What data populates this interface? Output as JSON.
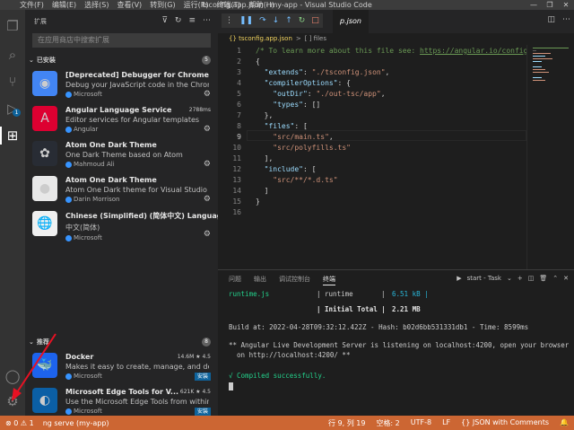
{
  "titlebar": {
    "menu": [
      "文件(F)",
      "编辑(E)",
      "选择(S)",
      "查看(V)",
      "转到(G)",
      "运行(R)",
      "终端(T)",
      "帮助(H)"
    ],
    "title": "tsconfig.app.json - my-app - Visual Studio Code",
    "controls": [
      "—",
      "❐",
      "✕"
    ]
  },
  "activity": {
    "badge": "1"
  },
  "sidebar": {
    "header": "扩展",
    "search_placeholder": "在应用商店中搜索扩展",
    "installed": {
      "label": "已安装",
      "count": "5"
    },
    "recommended": {
      "label": "推荐",
      "count": "8"
    },
    "installed_items": [
      {
        "name": "[Deprecated] Debugger for Chrome",
        "desc": "Debug your JavaScript code in the Chrome ...",
        "pub": "Microsoft",
        "color": "#4285f4",
        "glyph": "◉"
      },
      {
        "name": "Angular Language Service",
        "desc": "Editor services for Angular templates",
        "pub": "Angular",
        "meta": "2788ms",
        "color": "#dd0031",
        "glyph": "A"
      },
      {
        "name": "Atom One Dark Theme",
        "desc": "One Dark Theme based on Atom",
        "pub": "Mahmoud Ali",
        "color": "#282c34",
        "glyph": "✿"
      },
      {
        "name": "Atom One Dark Theme",
        "desc": "Atom One Dark theme for Visual Studio Co...",
        "pub": "Darin Morrison",
        "color": "#e8e8e8",
        "glyph": "●"
      },
      {
        "name": "Chinese (Simplified) (简体中文) Languag...",
        "desc": "中文(简体)",
        "pub": "Microsoft",
        "color": "#f0f0f0",
        "glyph": "🌐"
      }
    ],
    "recommended_items": [
      {
        "name": "Docker",
        "desc": "Makes it easy to create, manage, and debu...",
        "pub": "Microsoft",
        "meta": "14.6M ★ 4.5",
        "install": "安装",
        "color": "#1d63ed",
        "glyph": "🐳"
      },
      {
        "name": "Microsoft Edge Tools for V...",
        "desc": "Use the Microsoft Edge Tools from within V...",
        "pub": "Microsoft",
        "meta": "621K ★ 4.5",
        "install": "安装",
        "color": "#0b5fa5",
        "glyph": "◐"
      }
    ]
  },
  "editor": {
    "tab": "tsconfig.app.json",
    "tab_visible": "p.json",
    "breadcrumb": [
      "{} tsconfig.app.json",
      ">",
      "[ ] files"
    ],
    "lines": [
      "/* To learn more about this file see: https://angular.io/config",
      "{",
      "  \"extends\": \"./tsconfig.json\",",
      "  \"compilerOptions\": {",
      "    \"outDir\": \"./out-tsc/app\",",
      "    \"types\": []",
      "  },",
      "  \"files\": [",
      "    \"src/main.ts\",",
      "    \"src/polyfills.ts\"",
      "  ],",
      "  \"include\": [",
      "    \"src/**/*.d.ts\"",
      "  ]",
      "}",
      ""
    ]
  },
  "panel": {
    "tabs": [
      "问题",
      "输出",
      "调试控制台",
      "终端"
    ],
    "active_tab": "终端",
    "task": "start - Task",
    "terminal": [
      {
        "a": "runtime.js",
        "b": "| runtime",
        "c": "|",
        "d": "6.51 kB |"
      },
      {
        "a": "",
        "b": "| Initial Total |",
        "c": "",
        "d": "2.21 MB"
      },
      {
        "line": "Build at: 2022-04-28T09:32:12.422Z - Hash: b02d6bb531331db1 - Time: 8599ms"
      },
      {
        "line": "** Angular Live Development Server is listening on localhost:4200, open your browser"
      },
      {
        "line": "  on http://localhost:4200/ **"
      },
      {
        "line": "√ Compiled successfully."
      }
    ]
  },
  "status": {
    "left": [
      "⊗ 0 ⚠ 1",
      "ng serve (my-app)"
    ],
    "right": [
      "行 9, 列 19",
      "空格: 2",
      "UTF-8",
      "LF",
      "{} JSON with Comments"
    ]
  }
}
